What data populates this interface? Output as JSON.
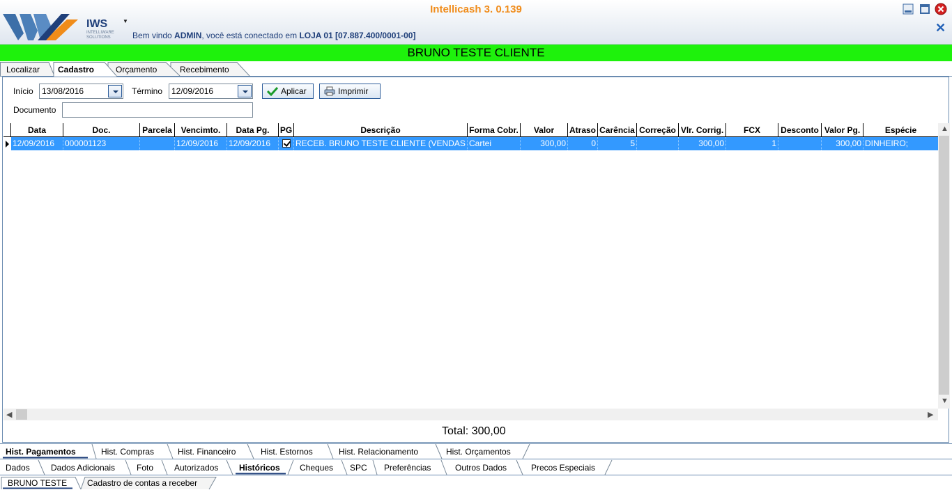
{
  "header": {
    "app_title": "Intellicash 3. 0.139",
    "logo_text": "IWS",
    "logo_subtitle": "INTELLIWARE SOLUTIONS",
    "welcome_prefix": "Bem vindo ",
    "welcome_user": "ADMIN",
    "welcome_middle": ", você está conectado em ",
    "welcome_store": "LOJA 01 [07.887.400/0001-00]"
  },
  "banner": {
    "customer_name": "BRUNO TESTE CLIENTE"
  },
  "top_tabs": [
    "Localizar",
    "Cadastro",
    "Orçamento",
    "Recebimento"
  ],
  "filters": {
    "start_label": "Início",
    "start_value": "13/08/2016",
    "end_label": "Término",
    "end_value": "12/09/2016",
    "apply_label": "Aplicar",
    "print_label": "Imprimir",
    "document_label": "Documento",
    "document_value": ""
  },
  "grid": {
    "columns": [
      "Data",
      "Doc.",
      "Parcela",
      "Vencimto.",
      "Data Pg.",
      "PG",
      "Descrição",
      "Forma Cobr.",
      "Valor",
      "Atraso",
      "Carência",
      "Correção",
      "Vlr. Corrig.",
      "FCX",
      "Desconto",
      "Valor Pg.",
      "Espécie"
    ],
    "rows": [
      {
        "data": "12/09/2016",
        "doc": "000001123",
        "parcela": "",
        "vencimento": "12/09/2016",
        "data_pg": "12/09/2016",
        "pg": true,
        "descricao": "RECEB. BRUNO TESTE CLIENTE (VENDAS  C.",
        "forma_cobr": "Cartei",
        "valor": "300,00",
        "atraso": "0",
        "carencia": "5",
        "correcao": "",
        "vlr_corrig": "300,00",
        "fcx": "1",
        "desconto": "",
        "valor_pg": "300,00",
        "especie": "DINHEIRO;"
      }
    ]
  },
  "total": "Total: 300,00",
  "history_tabs": [
    "Hist. Pagamentos",
    "Hist. Compras",
    "Hist. Financeiro",
    "Hist. Estornos",
    "Hist. Relacionamento",
    "Hist. Orçamentos"
  ],
  "section_tabs": [
    "Dados",
    "Dados Adicionais",
    "Foto",
    "Autorizados",
    "Históricos",
    "Cheques",
    "SPC",
    "Preferências",
    "Outros Dados",
    "Precos Especiais"
  ],
  "window_tabs": [
    "BRUNO TESTE",
    "Cadastro de contas a receber"
  ],
  "colors": {
    "accent_title": "#f08c1a",
    "banner": "#1ef20c",
    "selection": "#3399ff",
    "brand_blue": "#1f3f7a"
  }
}
